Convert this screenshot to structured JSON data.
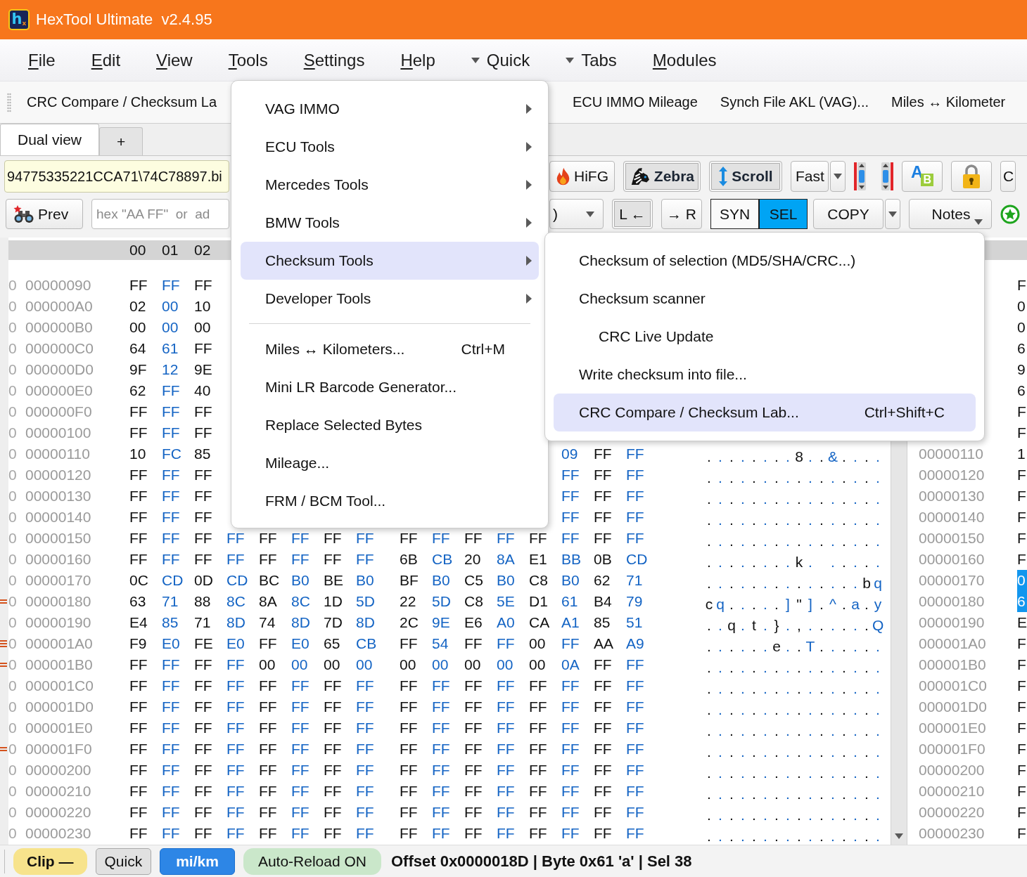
{
  "window": {
    "title": "HexTool Ultimate  v2.4.95",
    "logo": "h$_{x}$"
  },
  "menu_bar": [
    {
      "kind": "menu",
      "label": "File",
      "underline_first": true
    },
    {
      "kind": "menu",
      "label": "Edit",
      "underline_first": true
    },
    {
      "kind": "menu",
      "label": "View",
      "underline_first": true
    },
    {
      "kind": "menu",
      "label": "Tools",
      "underline_first": true
    },
    {
      "kind": "menu",
      "label": "Settings",
      "underline_first": true
    },
    {
      "kind": "menu",
      "label": "Help",
      "underline_first": true
    },
    {
      "kind": "dropdown",
      "label": "Quick"
    },
    {
      "kind": "dropdown",
      "label": "Tabs"
    },
    {
      "kind": "menu",
      "label": "Modules",
      "underline_first": true
    }
  ],
  "quick_bar": [
    {
      "label": "CRC Compare / Checksum La"
    },
    {
      "label": "ECU IMMO Mileage"
    },
    {
      "label": "Synch File AKL (VAG)..."
    },
    {
      "label": "Miles ↔ Kilometer"
    }
  ],
  "tabs": [
    {
      "label": "Dual view",
      "selected": true
    },
    {
      "label": "+",
      "selected": false
    }
  ],
  "file_path": {
    "value": "94775335221CCA71\\74C78897.bi"
  },
  "toolbar_top": {
    "hifg": {
      "label": "HiFG"
    },
    "zebra": {
      "label": "Zebra",
      "on": true
    },
    "scroll": {
      "label": "Scroll",
      "on": true
    },
    "speed": {
      "value": "Fast"
    },
    "case_toggle": {
      "letters": [
        "A",
        "B"
      ]
    },
    "more": {
      "label": "C"
    }
  },
  "toolbar_bottom": {
    "prev": {
      "label": "Prev"
    },
    "search": {
      "placeholder": "hex \"AA FF\"  or  ad"
    },
    "view_select": {
      "value": ")"
    },
    "sync_left": {
      "label": "L ←",
      "on": true
    },
    "sync_right": {
      "label": "→ R",
      "on": false
    },
    "sync_mode": [
      {
        "label": "SYN",
        "selected": false
      },
      {
        "label": "SEL",
        "selected": true
      }
    ],
    "copy": {
      "label": "COPY"
    },
    "notes": {
      "label": "Notes"
    }
  },
  "hex_view": {
    "columns": [
      "00",
      "01",
      "02"
    ],
    "rows": [
      {
        "address": "00000090",
        "gutter": "0",
        "bytes": [
          "FF",
          "FF",
          "FF"
        ]
      },
      {
        "address": "000000A0",
        "gutter": "0",
        "bytes": [
          "02",
          "00",
          "10"
        ]
      },
      {
        "address": "000000B0",
        "gutter": "0",
        "bytes": [
          "00",
          "00",
          "00"
        ]
      },
      {
        "address": "000000C0",
        "gutter": "0",
        "bytes": [
          "64",
          "61",
          "FF"
        ]
      },
      {
        "address": "000000D0",
        "gutter": "0",
        "bytes": [
          "9F",
          "12",
          "9E"
        ]
      },
      {
        "address": "000000E0",
        "gutter": "0",
        "bytes": [
          "62",
          "FF",
          "40"
        ]
      },
      {
        "address": "000000F0",
        "gutter": "0",
        "bytes": [
          "FF",
          "FF",
          "FF"
        ]
      },
      {
        "address": "00000100",
        "gutter": "0",
        "bytes": [
          "FF",
          "FF",
          "FF"
        ]
      },
      {
        "address": "00000110",
        "gutter": "0",
        "bytes": [
          "10",
          "FC",
          "85"
        ],
        "tail": [
          "09",
          "FF",
          "FF"
        ],
        "ascii": ". . . . . . . . 8 . . & . . . ."
      },
      {
        "address": "00000120",
        "gutter": "0",
        "bytes": [
          "FF",
          "FF",
          "FF"
        ],
        "tail": [
          "FF",
          "FF",
          "FF"
        ],
        "ascii": ". . . . . . . . . . . . . . . ."
      },
      {
        "address": "00000130",
        "gutter": "0",
        "bytes": [
          "FF",
          "FF",
          "FF"
        ],
        "tail": [
          "FF",
          "FF",
          "FF"
        ],
        "ascii": ". . . . . . . . . . . . . . . ."
      },
      {
        "address": "00000140",
        "gutter": "0",
        "bytes": [
          "FF",
          "FF",
          "FF"
        ],
        "tail": [
          "FF",
          "FF",
          "FF"
        ],
        "ascii": ". . . . . . . . . . . . . . . ."
      },
      {
        "address": "00000150",
        "gutter": "0",
        "bytes": [
          "FF",
          "FF",
          "FF",
          "FF",
          "FF",
          "FF",
          "FF",
          "FF",
          "FF",
          "FF",
          "FF",
          "FF",
          "FF",
          "FF",
          "FF",
          "FF"
        ],
        "ascii": ". . . . . . . . . . . . . . . ."
      },
      {
        "address": "00000160",
        "gutter": "0",
        "bytes": [
          "FF",
          "FF",
          "FF",
          "FF",
          "FF",
          "FF",
          "FF",
          "FF",
          "6B",
          "CB",
          "20",
          "8A",
          "E1",
          "BB",
          "0B",
          "CD"
        ],
        "ascii": ". . . . . . . . k .   . . . . ."
      },
      {
        "address": "00000170",
        "gutter": "0",
        "bytes": [
          "0C",
          "CD",
          "0D",
          "CD",
          "BC",
          "B0",
          "BE",
          "B0",
          "BF",
          "B0",
          "C5",
          "B0",
          "C8",
          "B0",
          "62",
          "71"
        ],
        "ascii": ". . . . . . . . . . . . . . b q"
      },
      {
        "address": "00000180",
        "gutter": "0",
        "bytes": [
          "63",
          "71",
          "88",
          "8C",
          "8A",
          "8C",
          "1D",
          "5D",
          "22",
          "5D",
          "C8",
          "5E",
          "D1",
          "61",
          "B4",
          "79"
        ],
        "ascii": "c q . . . . . ] \" ] . ^ . a . y",
        "marker": {
          "kind": "double"
        }
      },
      {
        "address": "00000190",
        "gutter": "0",
        "bytes": [
          "E4",
          "85",
          "71",
          "8D",
          "74",
          "8D",
          "7D",
          "8D",
          "2C",
          "9E",
          "E6",
          "A0",
          "CA",
          "A1",
          "85",
          "51"
        ],
        "ascii": ". . q . t . } . , . . . . . . Q"
      },
      {
        "address": "000001A0",
        "gutter": "0",
        "bytes": [
          "F9",
          "E0",
          "FE",
          "E0",
          "FF",
          "E0",
          "65",
          "CB",
          "FF",
          "54",
          "FF",
          "FF",
          "00",
          "FF",
          "AA",
          "A9"
        ],
        "ascii": ". . . . . . e . . T . . . . . .",
        "marker": {
          "kind": "triple"
        }
      },
      {
        "address": "000001B0",
        "gutter": "0",
        "bytes": [
          "FF",
          "FF",
          "FF",
          "FF",
          "00",
          "00",
          "00",
          "00",
          "00",
          "00",
          "00",
          "00",
          "00",
          "0A",
          "FF",
          "FF"
        ],
        "ascii": ". . . . . . . . . . . . . . . .",
        "marker": {
          "kind": "double"
        }
      },
      {
        "address": "000001C0",
        "gutter": "0",
        "bytes": [
          "FF",
          "FF",
          "FF",
          "FF",
          "FF",
          "FF",
          "FF",
          "FF",
          "FF",
          "FF",
          "FF",
          "FF",
          "FF",
          "FF",
          "FF",
          "FF"
        ],
        "ascii": ". . . . . . . . . . . . . . . ."
      },
      {
        "address": "000001D0",
        "gutter": "0",
        "bytes": [
          "FF",
          "FF",
          "FF",
          "FF",
          "FF",
          "FF",
          "FF",
          "FF",
          "FF",
          "FF",
          "FF",
          "FF",
          "FF",
          "FF",
          "FF",
          "FF"
        ],
        "ascii": ". . . . . . . . . . . . . . . ."
      },
      {
        "address": "000001E0",
        "gutter": "0",
        "bytes": [
          "FF",
          "FF",
          "FF",
          "FF",
          "FF",
          "FF",
          "FF",
          "FF",
          "FF",
          "FF",
          "FF",
          "FF",
          "FF",
          "FF",
          "FF",
          "FF"
        ],
        "ascii": ". . . . . . . . . . . . . . . ."
      },
      {
        "address": "000001F0",
        "gutter": "0",
        "bytes": [
          "FF",
          "FF",
          "FF",
          "FF",
          "FF",
          "FF",
          "FF",
          "FF",
          "FF",
          "FF",
          "FF",
          "FF",
          "FF",
          "FF",
          "FF",
          "FF"
        ],
        "ascii": ". . . . . . . . . . . . . . . .",
        "marker": {
          "kind": "double"
        }
      },
      {
        "address": "00000200",
        "gutter": "0",
        "bytes": [
          "FF",
          "FF",
          "FF",
          "FF",
          "FF",
          "FF",
          "FF",
          "FF",
          "FF",
          "FF",
          "FF",
          "FF",
          "FF",
          "FF",
          "FF",
          "FF"
        ],
        "ascii": ". . . . . . . . . . . . . . . ."
      },
      {
        "address": "00000210",
        "gutter": "0",
        "bytes": [
          "FF",
          "FF",
          "FF",
          "FF",
          "FF",
          "FF",
          "FF",
          "FF",
          "FF",
          "FF",
          "FF",
          "FF",
          "FF",
          "FF",
          "FF",
          "FF"
        ],
        "ascii": ". . . . . . . . . . . . . . . ."
      },
      {
        "address": "00000220",
        "gutter": "0",
        "bytes": [
          "FF",
          "FF",
          "FF",
          "FF",
          "FF",
          "FF",
          "FF",
          "FF",
          "FF",
          "FF",
          "FF",
          "FF",
          "FF",
          "FF",
          "FF",
          "FF"
        ],
        "ascii": ". . . . . . . . . . . . . . . ."
      },
      {
        "address": "00000230",
        "gutter": "0",
        "bytes": [
          "FF",
          "FF",
          "FF",
          "FF",
          "FF",
          "FF",
          "FF",
          "FF",
          "FF",
          "FF",
          "FF",
          "FF",
          "FF",
          "FF",
          "FF",
          "FF"
        ],
        "ascii": ". . . . . . . . . . . . . . . ."
      }
    ]
  },
  "compare_view": {
    "rows": [
      {
        "byte": "F",
        "selected": false
      },
      {
        "byte": "0",
        "selected": false
      },
      {
        "byte": "0",
        "selected": false
      },
      {
        "byte": "6",
        "selected": false
      },
      {
        "byte": "9",
        "selected": false
      },
      {
        "byte": "6",
        "selected": false
      },
      {
        "byte": "F",
        "selected": false
      },
      {
        "byte": "F",
        "selected": false
      },
      {
        "address": "00000110",
        "byte": "1",
        "selected": false
      },
      {
        "address": "00000120",
        "byte": "F",
        "selected": false
      },
      {
        "address": "00000130",
        "byte": "F",
        "selected": false
      },
      {
        "address": "00000140",
        "byte": "F",
        "selected": false
      },
      {
        "address": "00000150",
        "byte": "F",
        "selected": false
      },
      {
        "address": "00000160",
        "byte": "F",
        "selected": false
      },
      {
        "address": "00000170",
        "byte": "0",
        "selected": true
      },
      {
        "address": "00000180",
        "byte": "6",
        "selected": true
      },
      {
        "address": "00000190",
        "byte": "E",
        "selected": false
      },
      {
        "address": "000001A0",
        "byte": "F",
        "selected": false
      },
      {
        "address": "000001B0",
        "byte": "F",
        "selected": false
      },
      {
        "address": "000001C0",
        "byte": "F",
        "selected": false
      },
      {
        "address": "000001D0",
        "byte": "F",
        "selected": false
      },
      {
        "address": "000001E0",
        "byte": "F",
        "selected": false
      },
      {
        "address": "000001F0",
        "byte": "F",
        "selected": false
      },
      {
        "address": "00000200",
        "byte": "F",
        "selected": false
      },
      {
        "address": "00000210",
        "byte": "F",
        "selected": false
      },
      {
        "address": "00000220",
        "byte": "F",
        "selected": false
      },
      {
        "address": "00000230",
        "byte": "F",
        "selected": false
      }
    ]
  },
  "status_bar": {
    "items": [
      {
        "kind": "clip",
        "label": "Clip —"
      },
      {
        "kind": "toggle",
        "label": "Quick"
      },
      {
        "kind": "units",
        "label": "mi/km"
      },
      {
        "kind": "reload",
        "label": "Auto-Reload ON"
      }
    ],
    "info": "Offset 0x0000018D | Byte 0x61 'a' | Sel 38"
  },
  "tools_menu": {
    "items": [
      {
        "kind": "item",
        "label": "VAG IMMO",
        "submenu": true,
        "selected": false
      },
      {
        "kind": "item",
        "label": "ECU Tools",
        "submenu": true,
        "selected": false
      },
      {
        "kind": "item",
        "label": "Mercedes Tools",
        "submenu": true,
        "selected": false
      },
      {
        "kind": "item",
        "label": "BMW Tools",
        "submenu": true,
        "selected": false
      },
      {
        "kind": "item",
        "label": "Checksum Tools",
        "submenu": true,
        "selected": true
      },
      {
        "kind": "item",
        "label": "Developer Tools",
        "submenu": true,
        "selected": false
      },
      {
        "kind": "separator"
      },
      {
        "kind": "item",
        "label": "Miles ↔ Kilometers...",
        "shortcut": "Ctrl+M",
        "submenu": false,
        "selected": false
      },
      {
        "kind": "item",
        "label": "Mini LR Barcode Generator...",
        "submenu": false,
        "selected": false
      },
      {
        "kind": "item",
        "label": "Replace Selected Bytes",
        "submenu": false,
        "selected": false
      },
      {
        "kind": "item",
        "label": "Mileage...",
        "submenu": false,
        "selected": false
      },
      {
        "kind": "item",
        "label": "FRM / BCM Tool...",
        "submenu": false,
        "selected": false
      }
    ]
  },
  "checksum_submenu": {
    "items": [
      {
        "kind": "item",
        "label": "Checksum of selection (MD5/SHA/CRC...)",
        "selected": false
      },
      {
        "kind": "item",
        "label": "Checksum scanner",
        "selected": false
      },
      {
        "kind": "indented",
        "label": "CRC Live Update",
        "selected": false
      },
      {
        "kind": "item",
        "label": "Write checksum into file...",
        "selected": false
      },
      {
        "kind": "item",
        "label": "CRC Compare / Checksum Lab...",
        "shortcut": "Ctrl+Shift+C",
        "selected": true
      }
    ]
  }
}
